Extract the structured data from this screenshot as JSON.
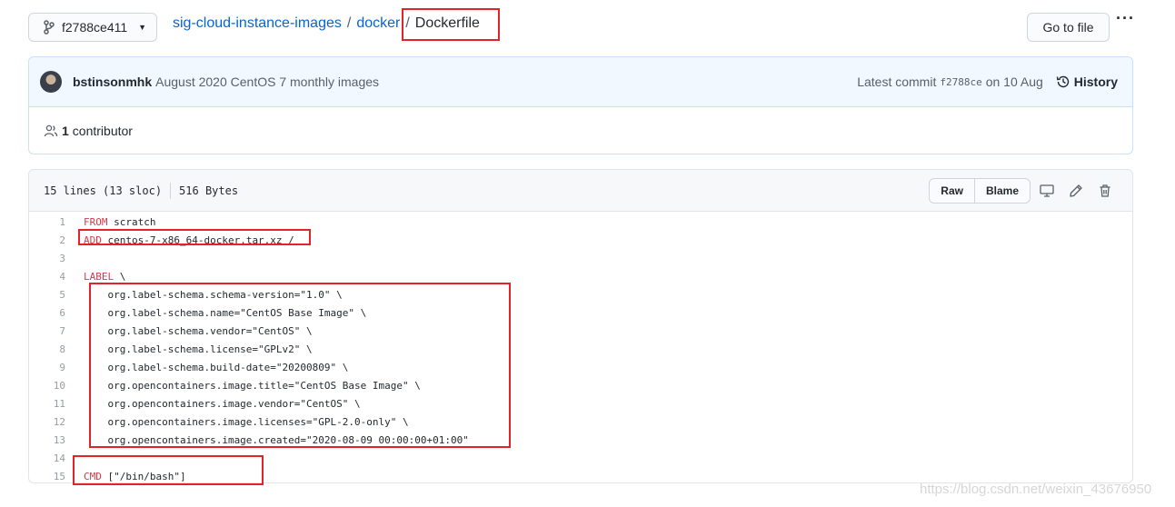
{
  "topbar": {
    "branch": "f2788ce411",
    "breadcrumb": {
      "repo": "sig-cloud-instance-images",
      "sep1": "/",
      "folder": "docker",
      "sep2": "/",
      "file": "Dockerfile"
    },
    "goto_file": "Go to file",
    "more": "···"
  },
  "commit": {
    "author": "bstinsonmhk",
    "message": "August 2020 CentOS 7 monthly images",
    "latest_prefix": "Latest commit",
    "sha": "f2788ce",
    "date_text": "on 10 Aug",
    "history": "History"
  },
  "contributors": {
    "count": "1",
    "label": "contributor"
  },
  "file": {
    "lines_info": "15 lines (13 sloc)",
    "size": "516 Bytes",
    "raw": "Raw",
    "blame": "Blame"
  },
  "code": [
    {
      "n": "1",
      "kw": "FROM",
      "text": " scratch"
    },
    {
      "n": "2",
      "kw": "ADD",
      "text": " centos-7-x86_64-docker.tar.xz /"
    },
    {
      "n": "3",
      "kw": "",
      "text": ""
    },
    {
      "n": "4",
      "kw": "LABEL",
      "text": " \\"
    },
    {
      "n": "5",
      "kw": "",
      "text": "    org.label-schema.schema-version=\"1.0\" \\"
    },
    {
      "n": "6",
      "kw": "",
      "text": "    org.label-schema.name=\"CentOS Base Image\" \\"
    },
    {
      "n": "7",
      "kw": "",
      "text": "    org.label-schema.vendor=\"CentOS\" \\"
    },
    {
      "n": "8",
      "kw": "",
      "text": "    org.label-schema.license=\"GPLv2\" \\"
    },
    {
      "n": "9",
      "kw": "",
      "text": "    org.label-schema.build-date=\"20200809\" \\"
    },
    {
      "n": "10",
      "kw": "",
      "text": "    org.opencontainers.image.title=\"CentOS Base Image\" \\"
    },
    {
      "n": "11",
      "kw": "",
      "text": "    org.opencontainers.image.vendor=\"CentOS\" \\"
    },
    {
      "n": "12",
      "kw": "",
      "text": "    org.opencontainers.image.licenses=\"GPL-2.0-only\" \\"
    },
    {
      "n": "13",
      "kw": "",
      "text": "    org.opencontainers.image.created=\"2020-08-09 00:00:00+01:00\""
    },
    {
      "n": "14",
      "kw": "",
      "text": ""
    },
    {
      "n": "15",
      "kw": "CMD",
      "text": " [\"/bin/bash\"]"
    }
  ],
  "watermark": "https://blog.csdn.net/weixin_43676950",
  "colors": {
    "link": "#0366d6",
    "keyword": "#d73a49",
    "annotation": "#e0242a"
  }
}
